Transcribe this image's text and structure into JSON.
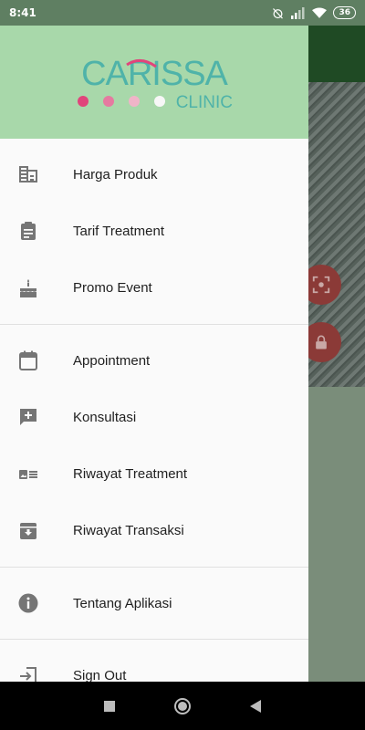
{
  "status_bar": {
    "time": "8:41",
    "battery": "36"
  },
  "logo": {
    "title": "CARISSA",
    "subtitle": "CLINIC"
  },
  "menu": {
    "groups": [
      [
        {
          "label": "Harga Produk",
          "icon": "building-icon"
        },
        {
          "label": "Tarif Treatment",
          "icon": "clipboard-icon"
        },
        {
          "label": "Promo Event",
          "icon": "cake-icon"
        }
      ],
      [
        {
          "label": "Appointment",
          "icon": "calendar-icon"
        },
        {
          "label": "Konsultasi",
          "icon": "add-comment-icon"
        },
        {
          "label": "Riwayat Treatment",
          "icon": "id-card-icon"
        },
        {
          "label": "Riwayat Transaksi",
          "icon": "archive-icon"
        }
      ],
      [
        {
          "label": "Tentang Aplikasi",
          "icon": "info-icon"
        }
      ],
      [
        {
          "label": "Sign Out",
          "icon": "sign-out-icon"
        }
      ]
    ]
  },
  "colors": {
    "header": "#a8d8aa",
    "logo_teal": "#4fb3a9",
    "logo_pink": "#e0457b",
    "appbar": "#1f4a24",
    "fab": "#8b3a37"
  }
}
